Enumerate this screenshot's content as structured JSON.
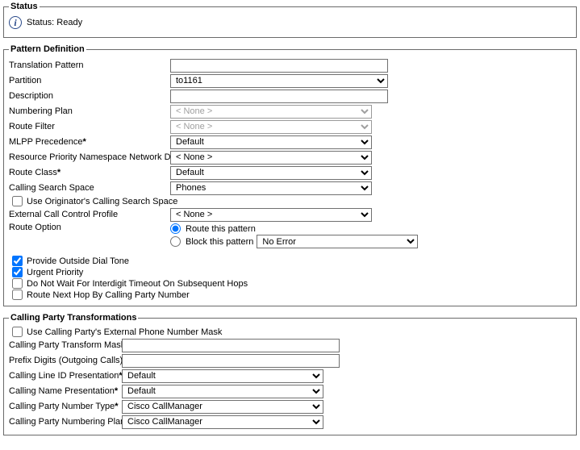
{
  "status": {
    "legend": "Status",
    "text": "Status: Ready"
  },
  "pattern": {
    "legend": "Pattern Definition",
    "translation_pattern": {
      "label": "Translation Pattern",
      "value": ""
    },
    "partition": {
      "label": "Partition",
      "value": "to1161"
    },
    "description": {
      "label": "Description",
      "value": ""
    },
    "numbering_plan": {
      "label": "Numbering Plan",
      "value": "< None >"
    },
    "route_filter": {
      "label": "Route Filter",
      "value": "< None >"
    },
    "mlpp": {
      "label": "MLPP Precedence",
      "value": "Default"
    },
    "rpnnd": {
      "label": "Resource Priority Namespace Network Domain",
      "value": "< None >"
    },
    "route_class": {
      "label": "Route Class",
      "value": "Default"
    },
    "css": {
      "label": "Calling Search Space",
      "value": "Phones"
    },
    "use_orig_css": {
      "label": "Use Originator's Calling Search Space"
    },
    "eccp": {
      "label": "External Call Control Profile",
      "value": "< None >"
    },
    "route_option": {
      "label": "Route Option",
      "route_label": "Route this pattern",
      "block_label": "Block this pattern",
      "block_value": "No Error"
    },
    "provide_dial_tone": {
      "label": "Provide Outside Dial Tone"
    },
    "urgent_priority": {
      "label": "Urgent Priority"
    },
    "no_wait": {
      "label": "Do Not Wait For Interdigit Timeout On Subsequent Hops"
    },
    "route_next_hop": {
      "label": "Route Next Hop By Calling Party Number"
    }
  },
  "cpt": {
    "legend": "Calling Party Transformations",
    "use_mask": {
      "label": "Use Calling Party's External Phone Number Mask"
    },
    "transform_mask": {
      "label": "Calling Party Transform Mask",
      "value": ""
    },
    "prefix_digits": {
      "label": "Prefix Digits (Outgoing Calls)",
      "value": ""
    },
    "clid_pres": {
      "label": "Calling Line ID Presentation",
      "value": "Default"
    },
    "cname_pres": {
      "label": "Calling Name Presentation",
      "value": "Default"
    },
    "cp_num_type": {
      "label": "Calling Party Number Type",
      "value": "Cisco CallManager"
    },
    "cp_num_plan": {
      "label": "Calling Party Numbering Plan",
      "value": "Cisco CallManager"
    }
  }
}
